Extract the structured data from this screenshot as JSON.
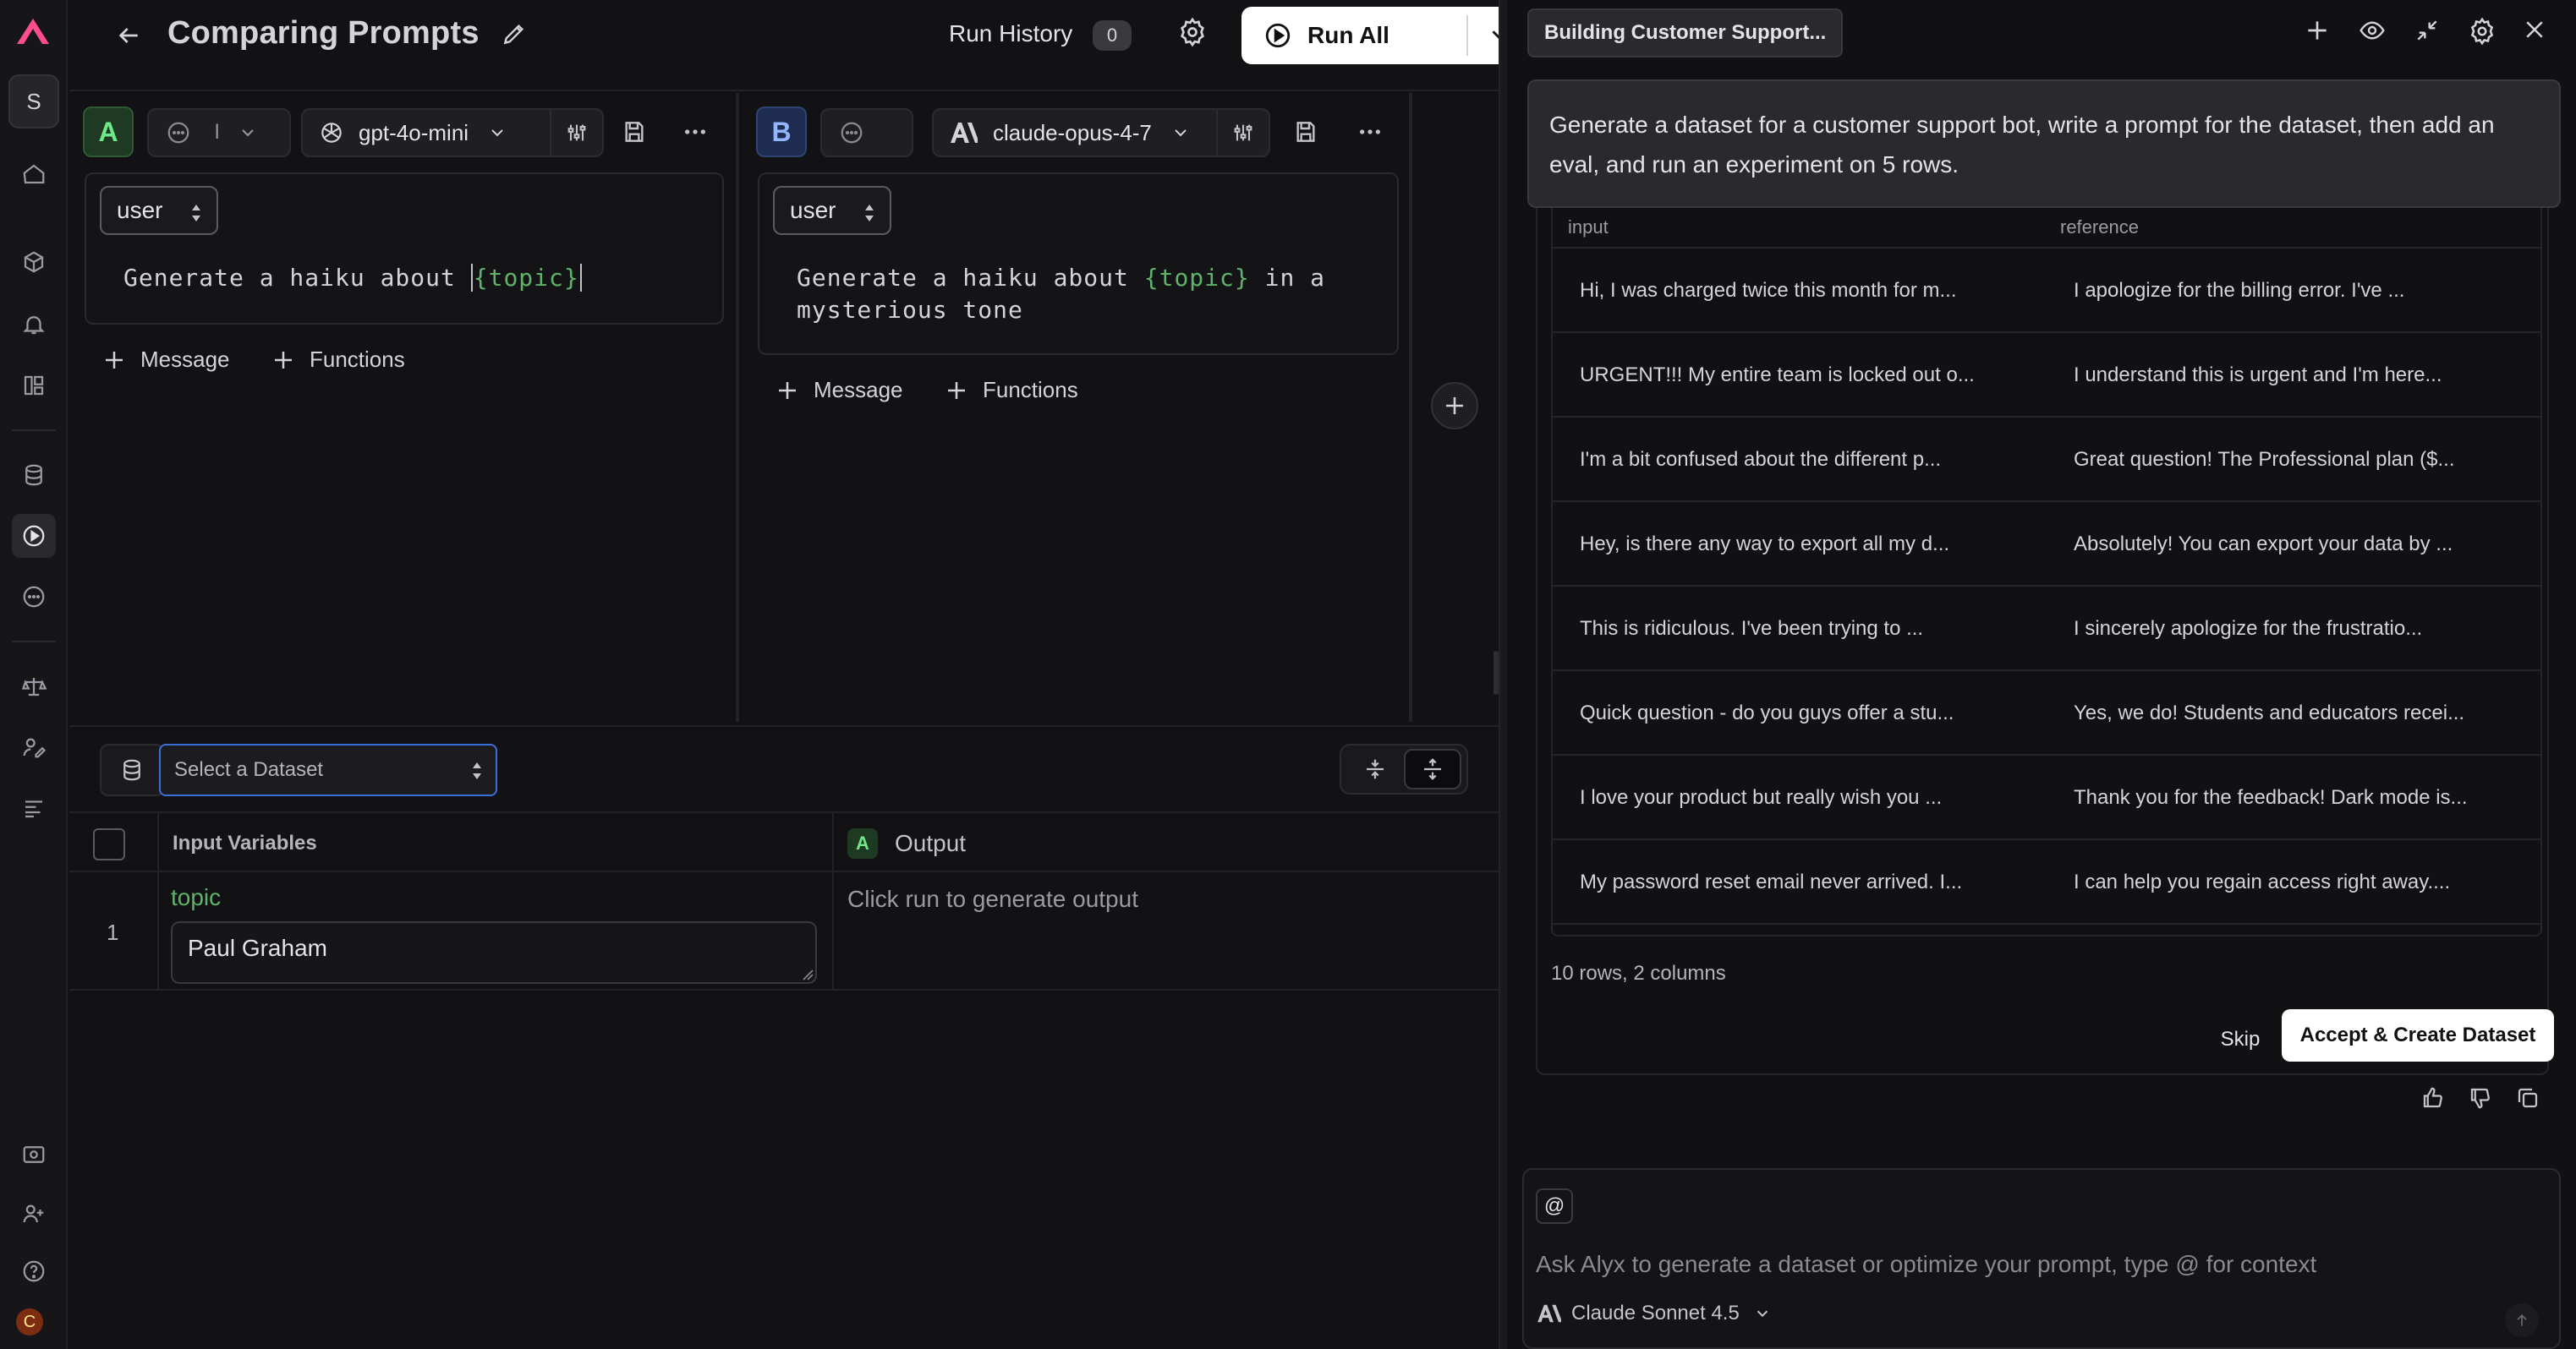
{
  "app": {
    "workspace_initial": "S",
    "user_initial": "C",
    "colors": {
      "accent_pink": "#ff4d8d",
      "variable_green": "#5fb36a",
      "focus_blue": "#3b6fd8"
    }
  },
  "header": {
    "title": "Comparing Prompts",
    "run_history_label": "Run History",
    "run_history_count": "0",
    "run_all_label": "Run All"
  },
  "panes": [
    {
      "letter": "A",
      "message_type_short": "l",
      "model": "gpt-4o-mini",
      "role": "user",
      "prompt_prefix": "Generate a haiku about ",
      "prompt_var": "{topic}",
      "add_message_label": "Message",
      "add_functions_label": "Functions"
    },
    {
      "letter": "B",
      "model": "claude-opus-4-7",
      "role": "user",
      "prompt_line1_prefix": "Generate a haiku about ",
      "prompt_var": "{topic}",
      "prompt_line1_suffix": " in a",
      "prompt_line2": "mysterious tone",
      "add_message_label": "Message",
      "add_functions_label": "Functions"
    }
  ],
  "dataset": {
    "select_placeholder": "Select a Dataset",
    "col_input_variables": "Input Variables",
    "col_output_letter": "A",
    "col_output": "Output",
    "rows": [
      {
        "num": "1",
        "var_name": "topic",
        "value": "Paul Graham",
        "output": "Click run to generate output"
      }
    ]
  },
  "assistant": {
    "conversation_title": "Building Customer Support...",
    "user_message": "Generate a dataset for a customer support bot, write a prompt for the dataset, then add an eval, and run an experiment on 5 rows.",
    "table_headers": [
      "input",
      "reference"
    ],
    "table_rows": [
      [
        "Hi, I was charged twice this month for m...",
        "I apologize for the billing error. I've ..."
      ],
      [
        "URGENT!!! My entire team is locked out o...",
        "I understand this is urgent and I'm here..."
      ],
      [
        "I'm a bit confused about the different p...",
        "Great question! The Professional plan ($..."
      ],
      [
        "Hey, is there any way to export all my d...",
        "Absolutely! You can export your data by ..."
      ],
      [
        "This is ridiculous. I've been trying to ...",
        "I sincerely apologize for the frustratio..."
      ],
      [
        "Quick question - do you guys offer a stu...",
        "Yes, we do! Students and educators recei..."
      ],
      [
        "I love your product but really wish you ...",
        "Thank you for the feedback! Dark mode is..."
      ],
      [
        "My password reset email never arrived. I...",
        "I can help you regain access right away...."
      ]
    ],
    "rows_meta": "10 rows, 2 columns",
    "skip_label": "Skip",
    "accept_label": "Accept & Create Dataset",
    "at_label": "@",
    "composer_placeholder": "Ask Alyx to generate a dataset or optimize your prompt, type @ for context",
    "model_label": "Claude Sonnet 4.5"
  }
}
